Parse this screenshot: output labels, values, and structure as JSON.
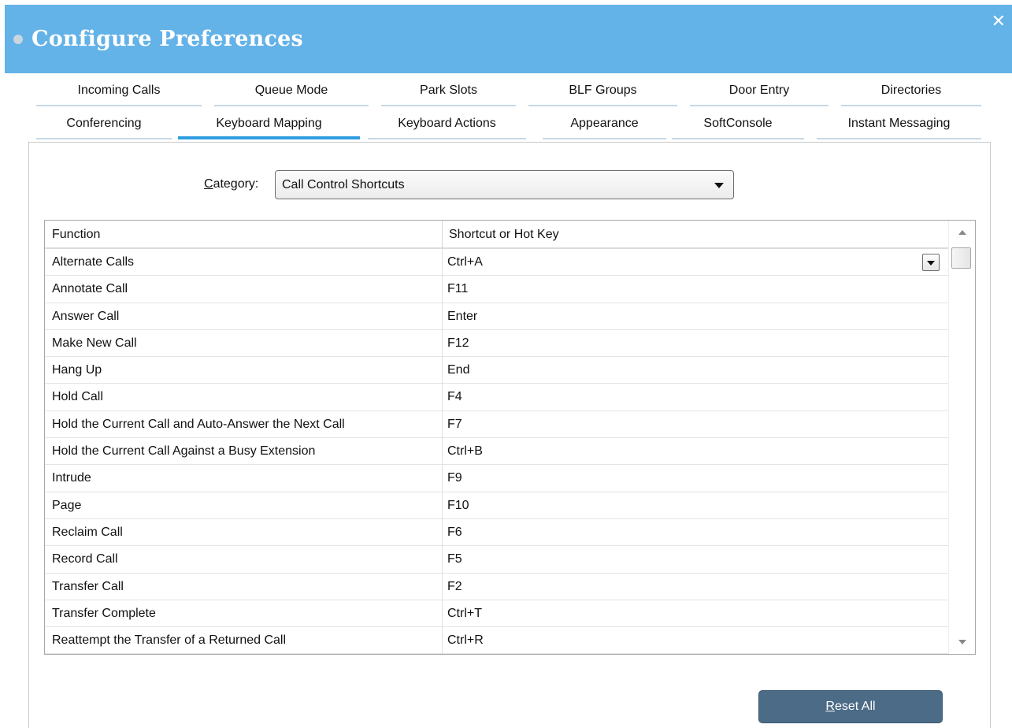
{
  "window": {
    "title": "Configure Preferences",
    "close_symbol": "✕"
  },
  "tabs": {
    "row1": [
      "Incoming Calls",
      "Queue Mode",
      "Park Slots",
      "BLF Groups",
      "Door Entry",
      "Directories"
    ],
    "row2": [
      "Conferencing",
      "Keyboard Mapping",
      "Keyboard Actions",
      "Appearance",
      "SoftConsole",
      "Instant Messaging"
    ],
    "active": "Keyboard Mapping"
  },
  "category": {
    "label_access_key": "C",
    "label_rest": "ategory:",
    "selected": "Call Control Shortcuts"
  },
  "table": {
    "columns": [
      "Function",
      "Shortcut or Hot Key"
    ],
    "rows": [
      {
        "function": "Alternate Calls",
        "shortcut": "Ctrl+A"
      },
      {
        "function": "Annotate Call",
        "shortcut": "F11"
      },
      {
        "function": "Answer Call",
        "shortcut": "Enter"
      },
      {
        "function": "Make New Call",
        "shortcut": "F12"
      },
      {
        "function": "Hang Up",
        "shortcut": "End"
      },
      {
        "function": "Hold Call",
        "shortcut": "F4"
      },
      {
        "function": "Hold the Current Call and Auto-Answer the Next Call",
        "shortcut": "F7"
      },
      {
        "function": "Hold the Current Call Against a Busy Extension",
        "shortcut": "Ctrl+B"
      },
      {
        "function": "Intrude",
        "shortcut": "F9"
      },
      {
        "function": "Page",
        "shortcut": "F10"
      },
      {
        "function": "Reclaim Call",
        "shortcut": "F6"
      },
      {
        "function": "Record Call",
        "shortcut": "F5"
      },
      {
        "function": "Transfer Call",
        "shortcut": "F2"
      },
      {
        "function": "Transfer Complete",
        "shortcut": "Ctrl+T"
      },
      {
        "function": "Reattempt the Transfer of a Returned Call",
        "shortcut": "Ctrl+R"
      }
    ]
  },
  "buttons": {
    "reset_access_key": "R",
    "reset_rest": "eset All"
  },
  "colors": {
    "titlebar": "#63b2e8",
    "active_tab_underline": "#2f9de0",
    "reset_button": "#4c6b87"
  },
  "icons": [
    "close-icon",
    "dropdown-arrow-icon",
    "scroll-up-icon",
    "scroll-down-icon"
  ]
}
